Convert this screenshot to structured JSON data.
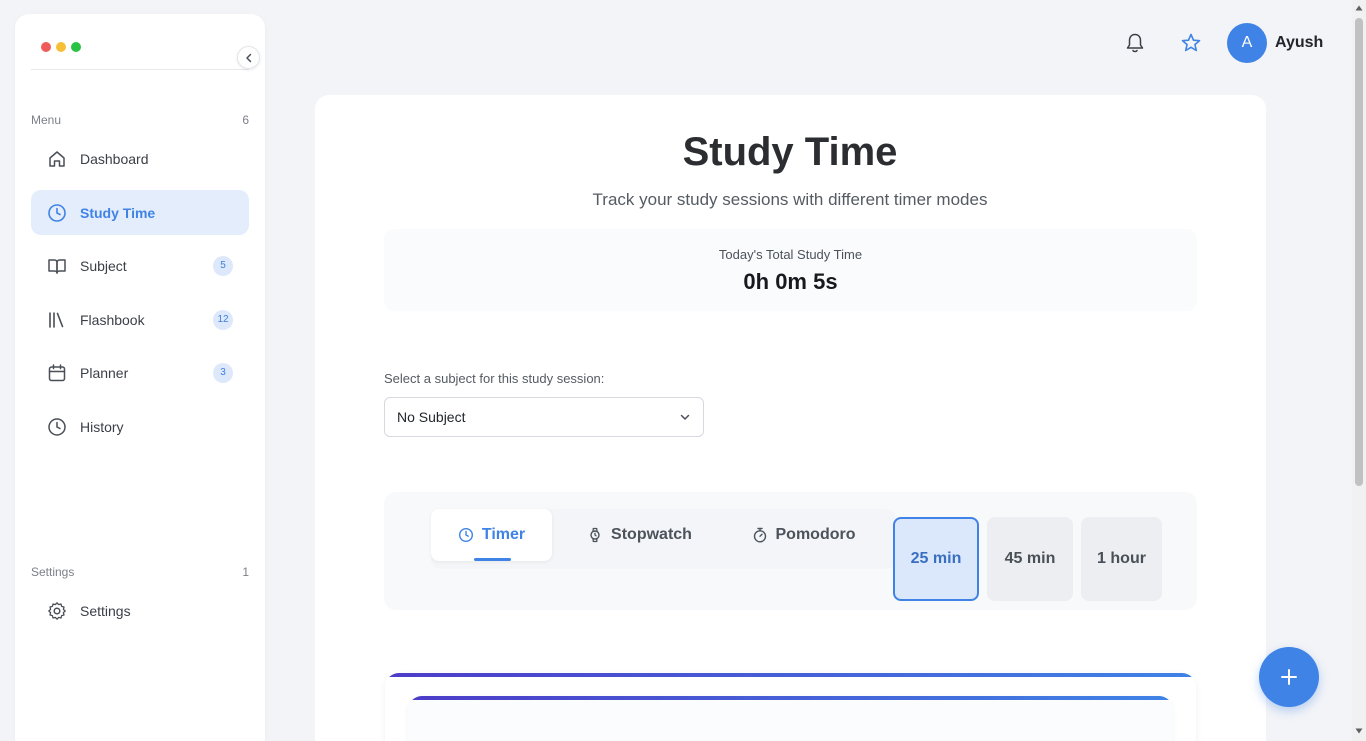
{
  "window": {
    "controls": [
      "close",
      "minimize",
      "maximize"
    ],
    "colors": [
      "#ef5b5b",
      "#f7be38",
      "#2ac245"
    ]
  },
  "sidebar": {
    "menu_label": "Menu",
    "menu_count": "6",
    "items": [
      {
        "label": "Dashboard",
        "icon": "home-icon",
        "badge": ""
      },
      {
        "label": "Study Time",
        "icon": "clock-icon",
        "badge": "",
        "active": true
      },
      {
        "label": "Subject",
        "icon": "book-icon",
        "badge": "5"
      },
      {
        "label": "Flashbook",
        "icon": "library-icon",
        "badge": "12"
      },
      {
        "label": "Planner",
        "icon": "calendar-icon",
        "badge": "3"
      },
      {
        "label": "History",
        "icon": "clock-icon",
        "badge": ""
      }
    ],
    "settings_label": "Settings",
    "settings_count": "1",
    "settings_item": {
      "label": "Settings",
      "icon": "gear-icon"
    }
  },
  "topbar": {
    "avatar_initial": "A",
    "username": "Ayush"
  },
  "main": {
    "title": "Study Time",
    "subtitle": "Track your study sessions with different timer modes",
    "total_label": "Today's Total Study Time",
    "total_value": "0h 0m 5s",
    "subject_label": "Select a subject for this study session:",
    "subject_value": "No Subject",
    "modes": [
      {
        "label": "Timer",
        "icon": "clock-icon",
        "active": true
      },
      {
        "label": "Stopwatch",
        "icon": "watch-icon",
        "active": false
      },
      {
        "label": "Pomodoro",
        "icon": "stopwatch-icon",
        "active": false
      }
    ],
    "durations": [
      {
        "label": "25 min",
        "selected": true
      },
      {
        "label": "45 min",
        "selected": false
      },
      {
        "label": "1 hour",
        "selected": false
      }
    ]
  },
  "colors": {
    "accent": "#3f83e6",
    "active_bg": "#e3edfc",
    "page_bg": "#f3f4f7"
  }
}
